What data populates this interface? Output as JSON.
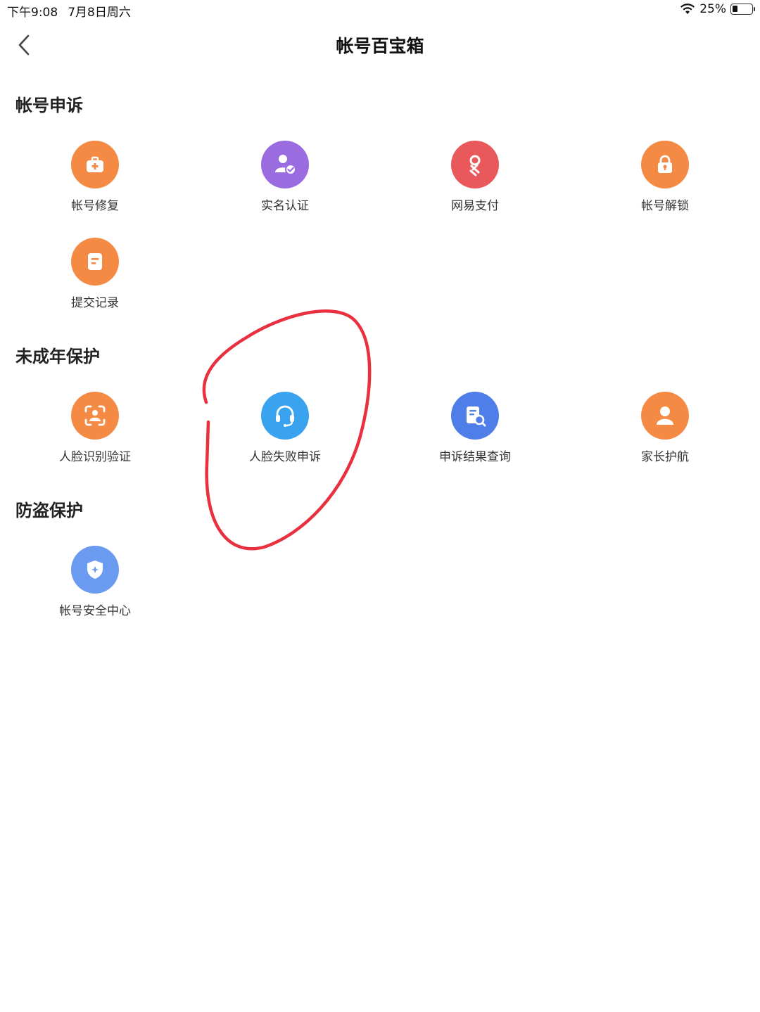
{
  "status_bar": {
    "time": "下午9:08",
    "date": "7月8日周六",
    "battery_text": "25%",
    "battery_level": 0.25
  },
  "nav": {
    "title": "帐号百宝箱",
    "back_icon": "chevron-left-icon"
  },
  "sections": [
    {
      "title": "帐号申诉",
      "items": [
        {
          "label": "帐号修复",
          "icon": "medical-bag-icon",
          "color": "#F58A45"
        },
        {
          "label": "实名认证",
          "icon": "verified-user-icon",
          "color": "#9B6BE0"
        },
        {
          "label": "网易支付",
          "icon": "pay-logo-icon",
          "color": "#E9585A"
        },
        {
          "label": "帐号解锁",
          "icon": "lock-icon",
          "color": "#F58A45"
        },
        {
          "label": "提交记录",
          "icon": "document-icon",
          "color": "#F58A45"
        }
      ]
    },
    {
      "title": "未成年保护",
      "items": [
        {
          "label": "人脸识别验证",
          "icon": "face-scan-icon",
          "color": "#F58A45"
        },
        {
          "label": "人脸失败申诉",
          "icon": "headset-icon",
          "color": "#3AA3F0"
        },
        {
          "label": "申诉结果查询",
          "icon": "document-search-icon",
          "color": "#4F7EE8"
        },
        {
          "label": "家长护航",
          "icon": "person-icon",
          "color": "#F58A45"
        }
      ]
    },
    {
      "title": "防盗保护",
      "items": [
        {
          "label": "帐号安全中心",
          "icon": "shield-icon",
          "color": "#6B9BF0"
        }
      ]
    }
  ],
  "annotation_color": "#E8303E"
}
